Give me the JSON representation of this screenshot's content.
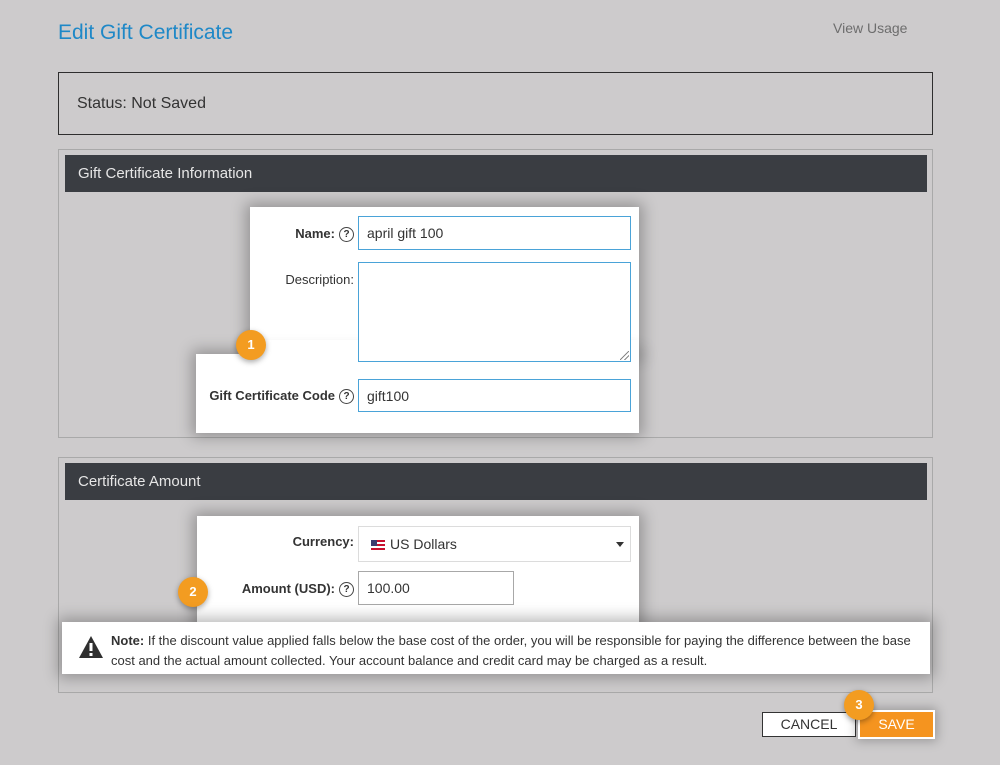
{
  "header": {
    "title": "Edit Gift Certificate",
    "view_usage": "View Usage"
  },
  "status": {
    "text": "Status: Not Saved"
  },
  "info_panel": {
    "title": "Gift Certificate Information",
    "name_label": "Name:",
    "name_value": "april gift 100",
    "description_label": "Description:",
    "description_value": "",
    "code_label": "Gift Certificate Code",
    "code_value": "gift100",
    "help_glyph": "?"
  },
  "amount_panel": {
    "title": "Certificate Amount",
    "currency_label": "Currency:",
    "currency_value": "US Dollars",
    "amount_label": "Amount (USD):",
    "amount_value": "100.00",
    "help_glyph": "?"
  },
  "note": {
    "label": "Note:",
    "text": " If the discount value applied falls below the base cost of the order, you will be responsible for paying the difference between the base cost and the actual amount collected. Your account balance and credit card may be charged as a result."
  },
  "badges": [
    "1",
    "2",
    "3"
  ],
  "actions": {
    "cancel_label": "CANCEL",
    "save_label": "SAVE"
  },
  "colors": {
    "accent": "#1e88c7",
    "badge": "#f39c21",
    "save": "#f5941f",
    "panel_header": "#3a3d42"
  },
  "icons": {
    "help": "question-circle-icon",
    "warning": "warning-triangle-icon",
    "dropdown": "caret-down-icon",
    "currency_flag": "us-flag-icon"
  }
}
